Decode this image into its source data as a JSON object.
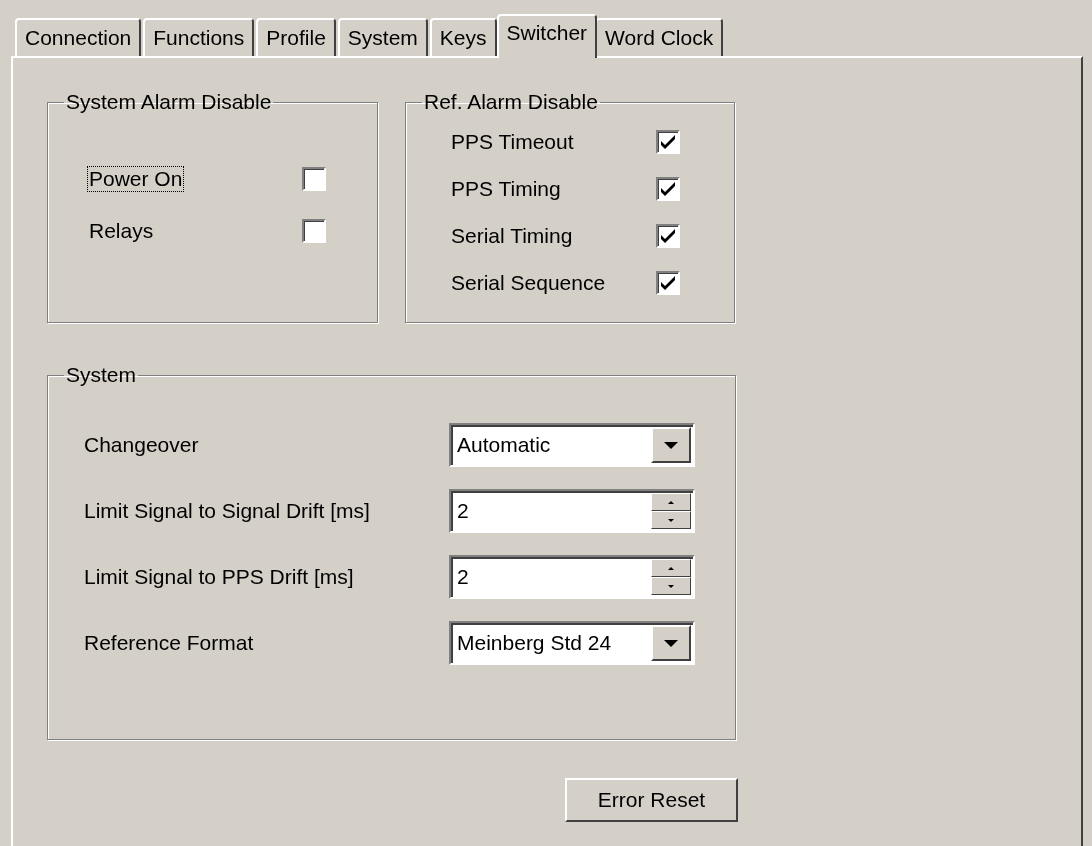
{
  "tabs": [
    {
      "label": "Connection",
      "selected": false
    },
    {
      "label": "Functions",
      "selected": false
    },
    {
      "label": "Profile",
      "selected": false
    },
    {
      "label": "System",
      "selected": false
    },
    {
      "label": "Keys",
      "selected": false
    },
    {
      "label": "Switcher",
      "selected": true
    },
    {
      "label": "Word Clock",
      "selected": false
    }
  ],
  "system_alarm_disable": {
    "title": "System Alarm Disable",
    "items": [
      {
        "label": "Power On",
        "checked": false,
        "focused": true
      },
      {
        "label": "Relays",
        "checked": false,
        "focused": false
      }
    ]
  },
  "ref_alarm_disable": {
    "title": "Ref. Alarm Disable",
    "items": [
      {
        "label": "PPS Timeout",
        "checked": true,
        "focused": false
      },
      {
        "label": "PPS Timing",
        "checked": true,
        "focused": false
      },
      {
        "label": "Serial Timing",
        "checked": true,
        "focused": false
      },
      {
        "label": "Serial Sequence",
        "checked": true,
        "focused": false
      }
    ]
  },
  "system": {
    "title": "System",
    "rows": [
      {
        "label": "Changeover",
        "kind": "dropdown",
        "value": "Automatic"
      },
      {
        "label": "Limit Signal to Signal Drift [ms]",
        "kind": "spin",
        "value": "2"
      },
      {
        "label": "Limit Signal to PPS Drift [ms]",
        "kind": "spin",
        "value": "2"
      },
      {
        "label": "Reference Format",
        "kind": "dropdown",
        "value": "Meinberg Std 24"
      }
    ]
  },
  "error_reset_button": "Error Reset"
}
